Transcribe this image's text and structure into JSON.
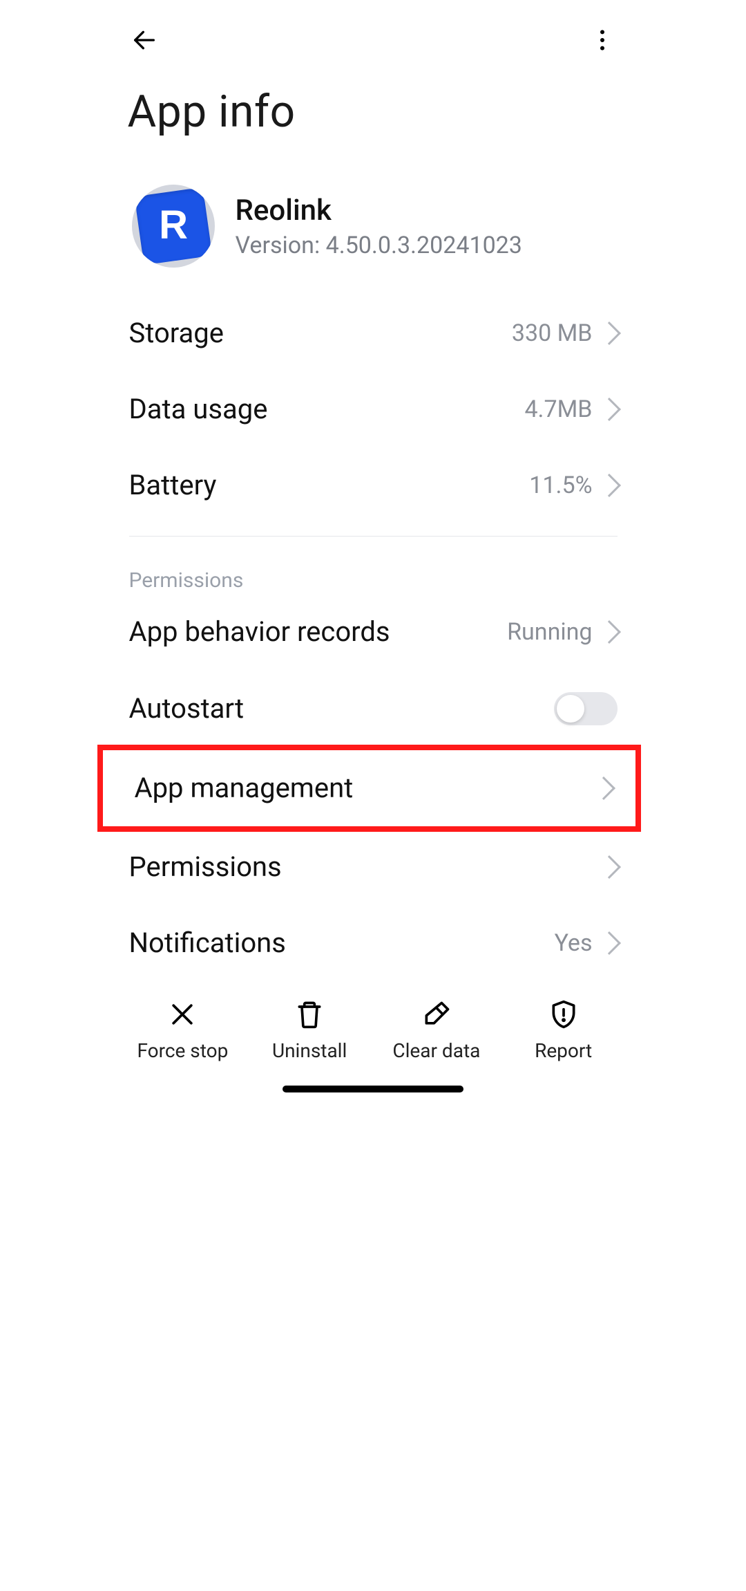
{
  "header": {
    "title": "App info"
  },
  "app": {
    "name": "Reolink",
    "version_prefix": "Version: ",
    "version": "4.50.0.3.20241023",
    "icon_letter": "R"
  },
  "rows": {
    "storage": {
      "label": "Storage",
      "value": "330 MB"
    },
    "data_usage": {
      "label": "Data usage",
      "value": "4.7MB"
    },
    "battery": {
      "label": "Battery",
      "value": "11.5%"
    },
    "behavior": {
      "label": "App behavior records",
      "value": "Running"
    },
    "autostart": {
      "label": "Autostart",
      "value": "off"
    },
    "app_mgmt": {
      "label": "App management"
    },
    "permissions": {
      "label": "Permissions"
    },
    "notifications": {
      "label": "Notifications",
      "value": "Yes"
    }
  },
  "sections": {
    "permissions": "Permissions"
  },
  "actions": {
    "force_stop": "Force stop",
    "uninstall": "Uninstall",
    "clear_data": "Clear data",
    "report": "Report"
  }
}
